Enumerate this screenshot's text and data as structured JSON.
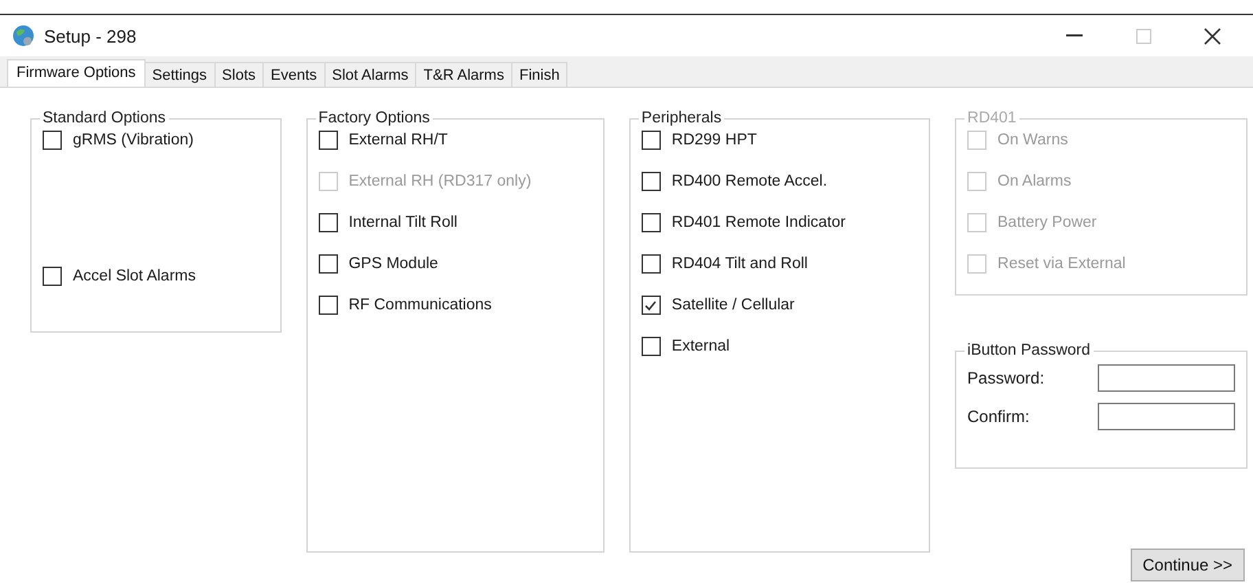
{
  "window": {
    "title": "Setup - 298"
  },
  "tabs": [
    {
      "label": "Firmware Options",
      "selected": true
    },
    {
      "label": "Settings",
      "selected": false
    },
    {
      "label": "Slots",
      "selected": false
    },
    {
      "label": "Events",
      "selected": false
    },
    {
      "label": "Slot Alarms",
      "selected": false
    },
    {
      "label": "T&R Alarms",
      "selected": false
    },
    {
      "label": "Finish",
      "selected": false
    }
  ],
  "groups": [
    {
      "title": "Standard Options",
      "disabled": false,
      "items": [
        {
          "label": "gRMS (Vibration)",
          "checked": false,
          "disabled": false
        },
        {
          "label": "Accel  Slot Alarms",
          "checked": false,
          "disabled": false
        }
      ]
    },
    {
      "title": "Factory Options",
      "disabled": false,
      "items": [
        {
          "label": "External RH/T",
          "checked": false,
          "disabled": false
        },
        {
          "label": "External RH (RD317 only)",
          "checked": false,
          "disabled": true
        },
        {
          "label": "Internal Tilt  Roll",
          "checked": false,
          "disabled": false
        },
        {
          "label": "GPS Module",
          "checked": false,
          "disabled": false
        },
        {
          "label": "RF Communications",
          "checked": false,
          "disabled": false
        }
      ]
    },
    {
      "title": "Peripherals",
      "disabled": false,
      "items": [
        {
          "label": "RD299 HPT",
          "checked": false,
          "disabled": false
        },
        {
          "label": "RD400 Remote Accel.",
          "checked": false,
          "disabled": false
        },
        {
          "label": "RD401 Remote Indicator",
          "checked": false,
          "disabled": false
        },
        {
          "label": "RD404 Tilt and Roll",
          "checked": false,
          "disabled": false
        },
        {
          "label": "Satellite / Cellular",
          "checked": true,
          "disabled": false
        },
        {
          "label": "External",
          "checked": false,
          "disabled": false
        }
      ]
    },
    {
      "title": "RD401",
      "disabled": true,
      "items": [
        {
          "label": "On Warns",
          "checked": false,
          "disabled": true
        },
        {
          "label": "On Alarms",
          "checked": false,
          "disabled": true
        },
        {
          "label": "Battery Power",
          "checked": false,
          "disabled": true
        },
        {
          "label": "Reset via External",
          "checked": false,
          "disabled": true
        }
      ]
    }
  ],
  "password_group": {
    "title": "iButton Password",
    "fields": [
      {
        "label": "Password:"
      },
      {
        "label": "Confirm:"
      }
    ]
  },
  "buttons": [
    "Continue >>"
  ]
}
